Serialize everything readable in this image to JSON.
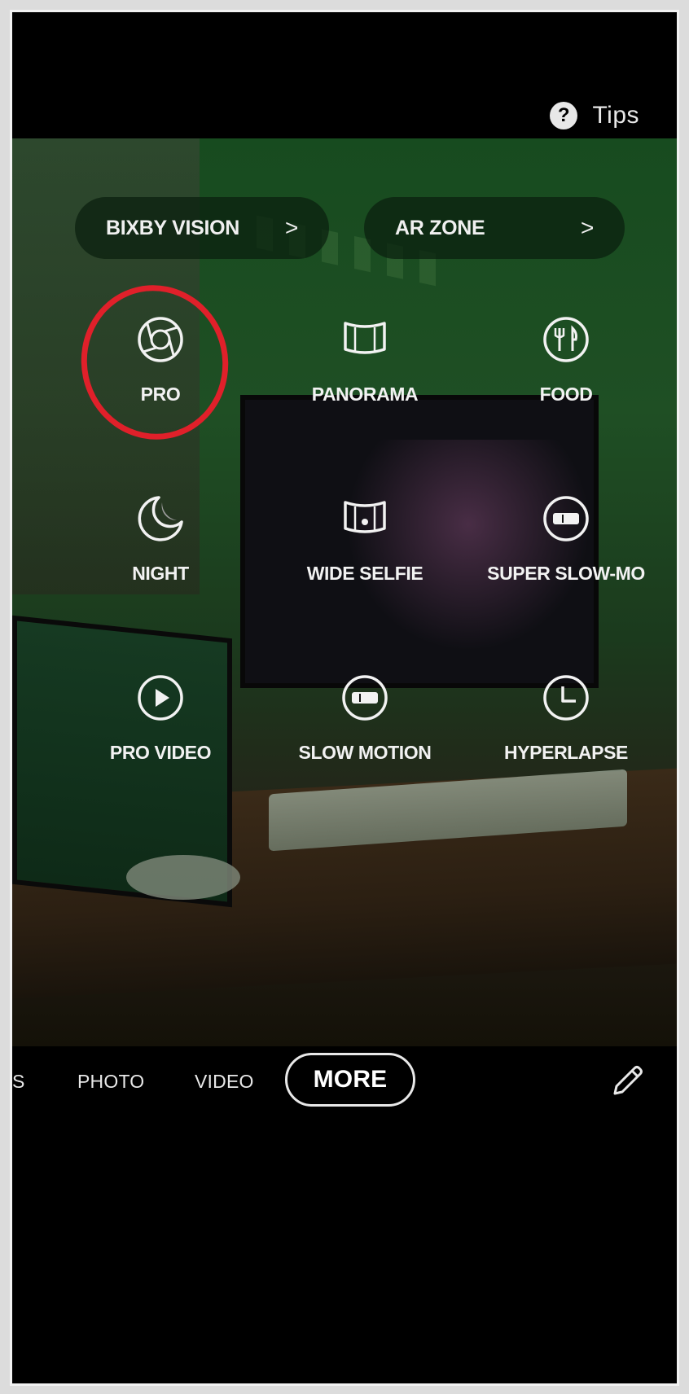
{
  "header": {
    "tips_label": "Tips"
  },
  "shortcuts": [
    {
      "label": "BIXBY VISION",
      "chevron": ">"
    },
    {
      "label": "AR ZONE",
      "chevron": ">"
    }
  ],
  "modes": [
    {
      "label": "PRO",
      "icon": "aperture-icon",
      "annotated": true
    },
    {
      "label": "PANORAMA",
      "icon": "panorama-icon"
    },
    {
      "label": "FOOD",
      "icon": "food-icon"
    },
    {
      "label": "NIGHT",
      "icon": "moon-icon"
    },
    {
      "label": "WIDE SELFIE",
      "icon": "wide-selfie-icon"
    },
    {
      "label": "SUPER SLOW-MO",
      "icon": "super-slow-mo-icon"
    },
    {
      "label": "PRO VIDEO",
      "icon": "play-icon"
    },
    {
      "label": "SLOW MOTION",
      "icon": "slow-motion-icon"
    },
    {
      "label": "HYPERLAPSE",
      "icon": "hyperlapse-icon"
    }
  ],
  "mode_bar": {
    "partial_label": "S",
    "photo_label": "PHOTO",
    "video_label": "VIDEO",
    "more_label": "MORE",
    "edit_icon": "pencil-icon"
  },
  "colors": {
    "annotation": "#e0202a",
    "scene_tint": "#1f4f24"
  }
}
